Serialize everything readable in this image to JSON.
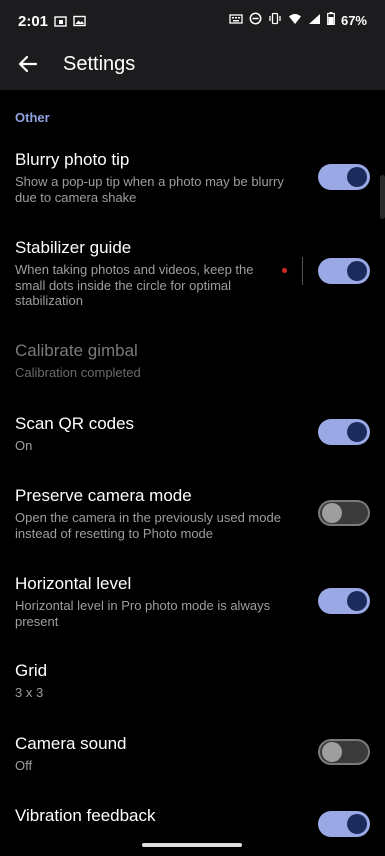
{
  "status_bar": {
    "time": "2:01",
    "battery": "67%",
    "left_icons": [
      "calendar-icon",
      "image-icon"
    ],
    "right_icons": [
      "keyboard-icon",
      "dnd-icon",
      "vibrate-icon",
      "wifi-icon",
      "signal-icon",
      "battery-icon"
    ]
  },
  "app_bar": {
    "title": "Settings",
    "back_icon": "arrow-left-icon"
  },
  "section": {
    "label": "Other"
  },
  "colors": {
    "accent": "#8fa2e0",
    "toggle_on": "#9aa8e6",
    "knob_on": "#1d2b5c"
  },
  "settings": [
    {
      "title": "Blurry photo tip",
      "subtitle": "Show a pop-up tip when a photo may be blurry due to camera shake",
      "toggle": true
    },
    {
      "title": "Stabilizer guide",
      "subtitle": "When taking photos and videos, keep the small dots inside the circle for optimal stabilization",
      "toggle": true
    },
    {
      "title": "Calibrate gimbal",
      "subtitle": "Calibration completed",
      "toggle": null,
      "disabled": true
    },
    {
      "title": "Scan QR codes",
      "subtitle": "On",
      "toggle": true
    },
    {
      "title": "Preserve camera mode",
      "subtitle": "Open the camera in the previously used mode instead of resetting to Photo mode",
      "toggle": false
    },
    {
      "title": "Horizontal level",
      "subtitle": "Horizontal level in Pro photo mode is always present",
      "toggle": true
    },
    {
      "title": "Grid",
      "subtitle": "3 x 3",
      "toggle": null
    },
    {
      "title": "Camera sound",
      "subtitle": "Off",
      "toggle": false
    },
    {
      "title": "Vibration feedback",
      "subtitle": "",
      "toggle": true
    }
  ]
}
